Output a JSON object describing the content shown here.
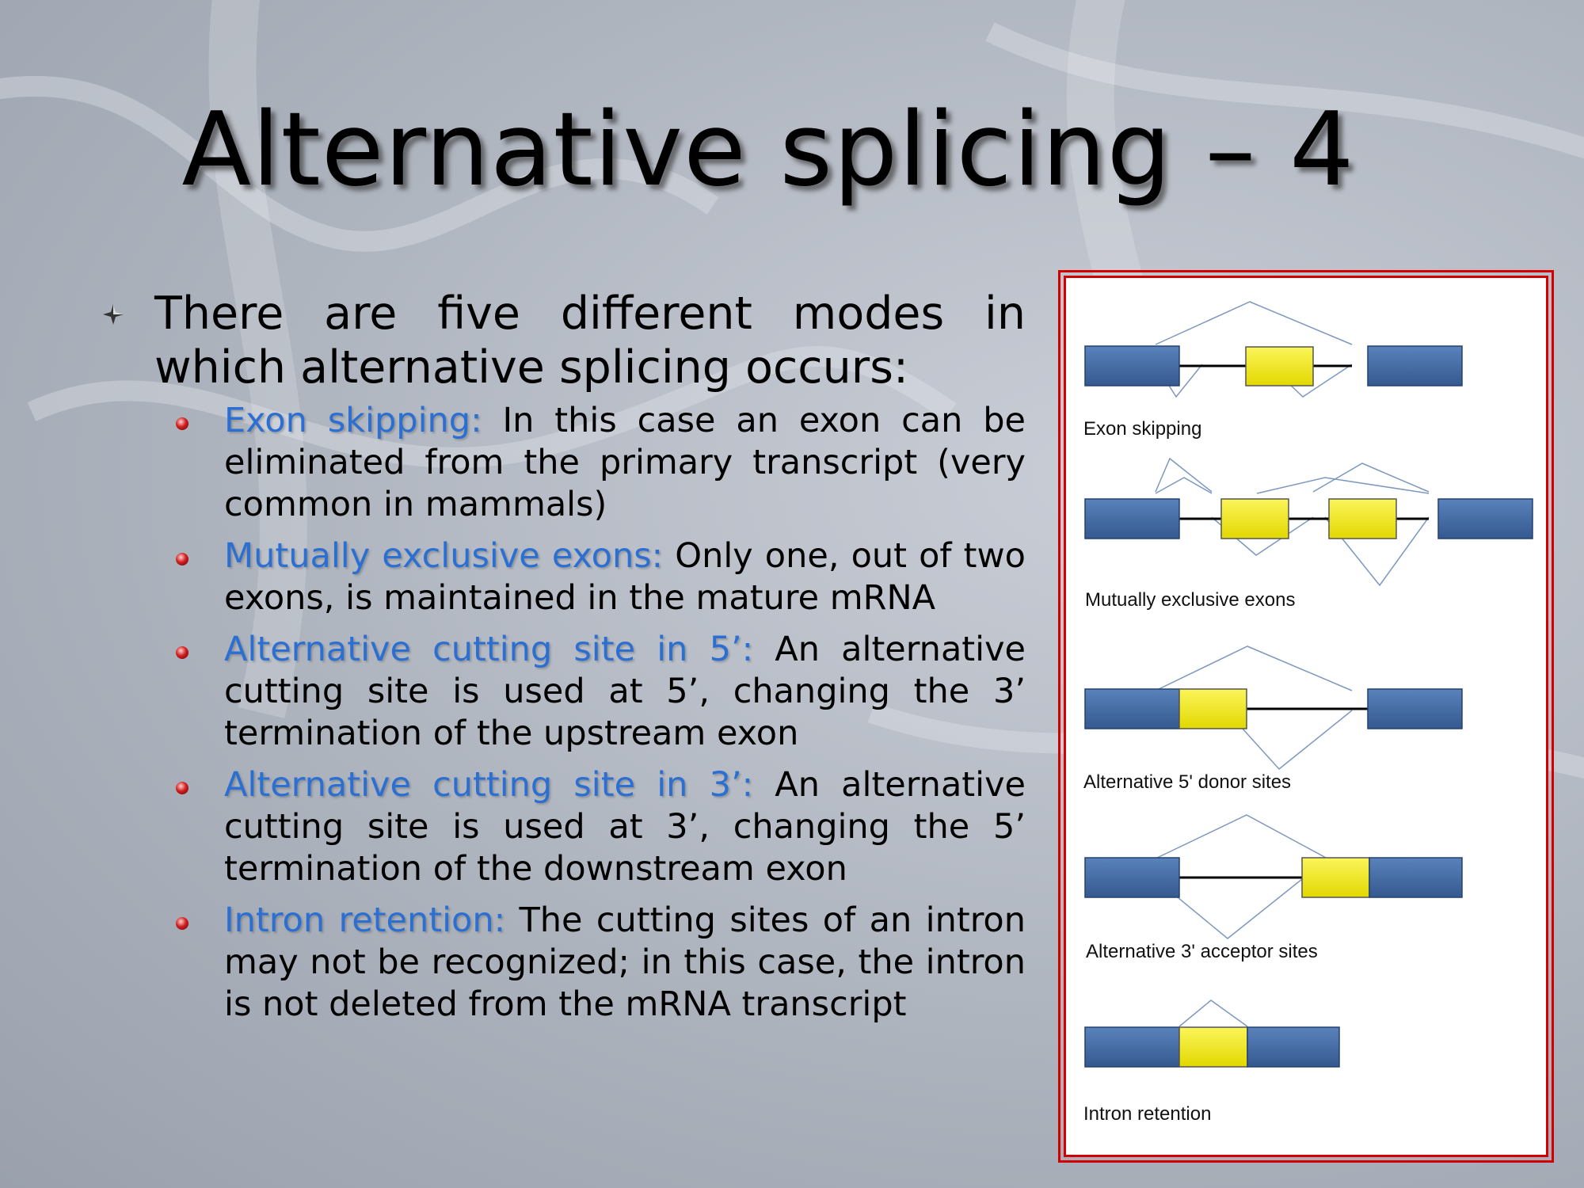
{
  "slide": {
    "title": "Alternative splicing – 4",
    "main_bullet": "There are five different modes in which alternative splicing occurs:",
    "items": [
      {
        "term": "Exon skipping:",
        "text": " In this case an exon can be eliminated from the primary transcript (very common in mammals)"
      },
      {
        "term": "Mutually exclusive exons:",
        "text": " Only one, out of two exons, is maintained in the mature mRNA"
      },
      {
        "term": "Alternative cutting site in 5’:",
        "text": " An alternative cutting site is used at 5’, changing the 3’ termination of the upstream exon"
      },
      {
        "term": "Alternative cutting site in 3’:",
        "text": " An alternative cutting site is used at 3’, changing the 5’ termination of the downstream exon"
      },
      {
        "term": "Intron retention:",
        "text": " The cutting sites of an intron may not be recognized; in this case, the intron is not deleted from the mRNA transcript"
      }
    ]
  },
  "figure": {
    "labels": [
      "Exon skipping",
      "Mutually exclusive exons",
      "Alternative 5' donor sites",
      "Alternative 3' acceptor sites",
      "Intron retention"
    ]
  },
  "colors": {
    "constitutive_exon": "#3f6aa6",
    "alternative_exon": "#f2ea00",
    "term_highlight": "#2a6fd1",
    "frame": "#d40000"
  }
}
